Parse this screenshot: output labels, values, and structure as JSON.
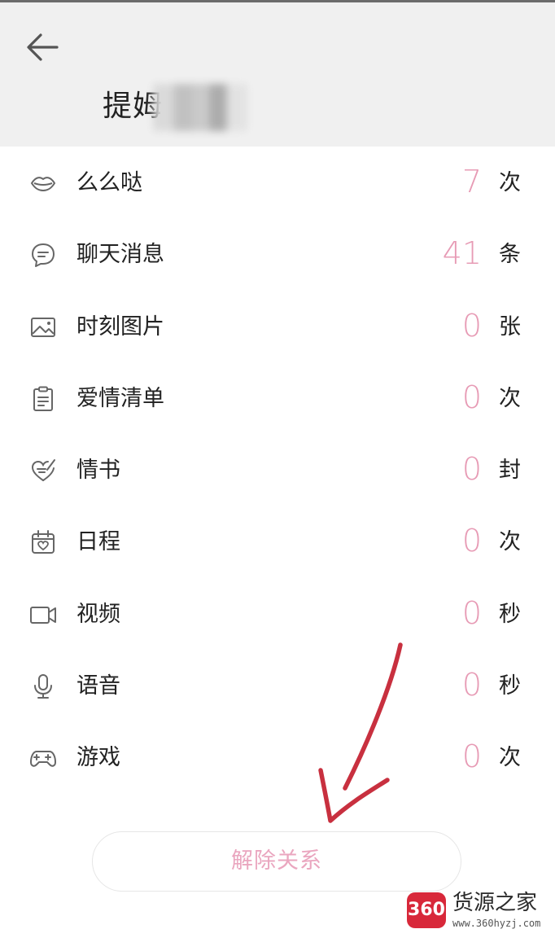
{
  "header": {
    "title": "提姆",
    "back_icon": "arrow-left-icon"
  },
  "stats": [
    {
      "icon": "lips-icon",
      "label": "么么哒",
      "value": "7",
      "unit": "次"
    },
    {
      "icon": "chat-bubble-icon",
      "label": "聊天消息",
      "value": "41",
      "unit": "条"
    },
    {
      "icon": "image-icon",
      "label": "时刻图片",
      "value": "0",
      "unit": "张"
    },
    {
      "icon": "clipboard-icon",
      "label": "爱情清单",
      "value": "0",
      "unit": "次"
    },
    {
      "icon": "love-letter-heart-icon",
      "label": "情书",
      "value": "0",
      "unit": "封"
    },
    {
      "icon": "calendar-heart-icon",
      "label": "日程",
      "value": "0",
      "unit": "次"
    },
    {
      "icon": "video-camera-icon",
      "label": "视频",
      "value": "0",
      "unit": "秒"
    },
    {
      "icon": "microphone-icon",
      "label": "语音",
      "value": "0",
      "unit": "秒"
    },
    {
      "icon": "gamepad-icon",
      "label": "游戏",
      "value": "0",
      "unit": "次"
    }
  ],
  "actions": {
    "unbind_label": "解除关系"
  },
  "watermark": {
    "badge": "360",
    "name": "货源之家",
    "url": "www.360hyzj.com"
  },
  "colors": {
    "accent_pink": "#e79bb5",
    "button_text_pink": "#eaa6bf",
    "annotation_red": "#c8303f",
    "header_bg": "#f0f0f0"
  }
}
